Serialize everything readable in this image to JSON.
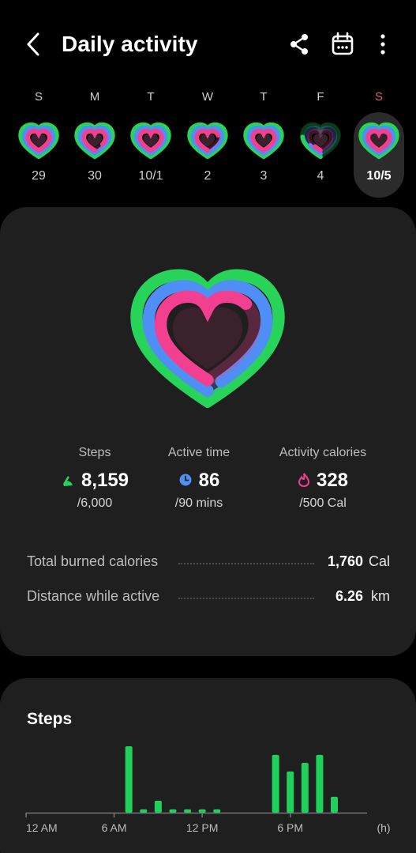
{
  "header": {
    "title": "Daily activity"
  },
  "week": [
    {
      "dow": "S",
      "date": "29",
      "rings": [
        1,
        1,
        1
      ]
    },
    {
      "dow": "M",
      "date": "30",
      "rings": [
        1,
        1,
        0.85
      ]
    },
    {
      "dow": "T",
      "date": "10/1",
      "rings": [
        1,
        1,
        1
      ]
    },
    {
      "dow": "W",
      "date": "2",
      "rings": [
        1,
        1,
        0.7
      ]
    },
    {
      "dow": "T",
      "date": "3",
      "rings": [
        1,
        1,
        1
      ]
    },
    {
      "dow": "F",
      "date": "4",
      "rings": [
        0.25,
        0.15,
        0.1
      ]
    },
    {
      "dow": "S",
      "date": "10/5",
      "rings": [
        1,
        1,
        1
      ]
    }
  ],
  "colors": {
    "steps_ring": "#28d35a",
    "time_ring": "#4f8ff5",
    "cal_ring": "#f23f8f",
    "accent_red": "#e0645d",
    "bar": "#1fd15b"
  },
  "summary": {
    "rings": {
      "steps": 1,
      "active_time": 0.955,
      "calories": 0.656
    },
    "steps": {
      "label": "Steps",
      "value": "8,159",
      "goal": "/6,000",
      "icon": "shoe-icon"
    },
    "active_time": {
      "label": "Active time",
      "value": "86",
      "goal": "/90 mins",
      "icon": "clock-icon"
    },
    "calories": {
      "label": "Activity calories",
      "value": "328",
      "goal": "/500 Cal",
      "icon": "flame-icon"
    },
    "total_burned": {
      "label": "Total burned calories",
      "value": "1,760",
      "unit": "Cal"
    },
    "distance": {
      "label": "Distance while active",
      "value": "6.26",
      "unit": "km"
    }
  },
  "steps_card": {
    "title": "Steps"
  },
  "chart_data": {
    "type": "bar",
    "x": [
      7,
      8,
      9,
      10,
      11,
      12,
      13,
      17,
      18,
      19,
      20,
      21
    ],
    "values": [
      1,
      0.05,
      0.18,
      0.05,
      0.05,
      0.05,
      0.05,
      0.87,
      0.62,
      0.75,
      0.87,
      0.24
    ],
    "tick_labels": [
      "12 AM",
      "6 AM",
      "12 PM",
      "6 PM"
    ],
    "ticks": [
      0,
      6,
      12,
      18
    ],
    "unit_label": "(h)",
    "xlim": [
      0,
      23.5
    ]
  }
}
